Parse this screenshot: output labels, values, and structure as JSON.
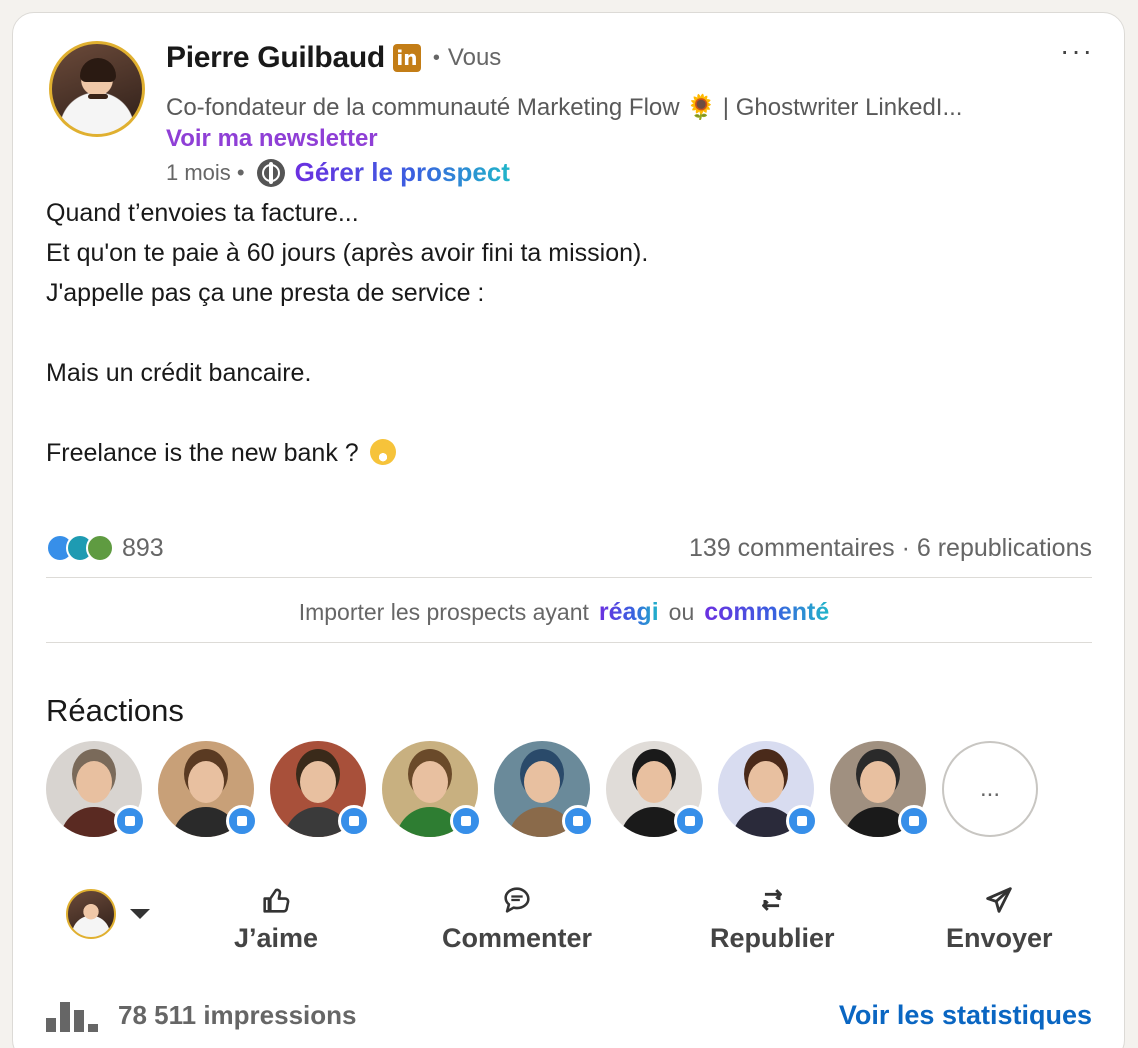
{
  "post": {
    "author": {
      "name": "Pierre Guilbaud",
      "badge": "in",
      "connection_separator": "•",
      "connection": "Vous",
      "headline": "Co-fondateur de la communauté Marketing Flow 🌻 | Ghostwriter LinkedI...",
      "newsletter_link": "Voir ma newsletter"
    },
    "meta": {
      "time": "1 mois •",
      "visibility_icon": "globe-icon",
      "prospect_link": "Gérer le prospect"
    },
    "more_menu": "···",
    "body_lines": [
      "Quand t’envoies ta facture...",
      "Et qu'on te paie à 60 jours (après avoir fini ta mission).",
      "J'appelle pas ça une presta de service :",
      "",
      "Mais un crédit bancaire.",
      "",
      "Freelance is the new bank ?"
    ],
    "body_emoji": "grinning-sweat-emoji"
  },
  "social_counts": {
    "reaction_icons": [
      "like",
      "funny",
      "celebrate"
    ],
    "reactions": "893",
    "comments_reposts": "139 commentaires · 6 republications"
  },
  "import_prospects": {
    "text": "Importer les prospects ayant",
    "reacted_link": "réagi",
    "or": "ou",
    "commented_link": "commenté"
  },
  "reactions_section": {
    "title": "Réactions",
    "more_label": "...",
    "reactors": [
      {
        "bg": "#d8d4d0",
        "body": "#5a2a22",
        "hair": "#7a6a5a"
      },
      {
        "bg": "#c8a078",
        "body": "#2a2a2a",
        "hair": "#5a3a22"
      },
      {
        "bg": "#a8503a",
        "body": "#3a3a3a",
        "hair": "#3a2a1a"
      },
      {
        "bg": "#c8b080",
        "body": "#2e7d32",
        "hair": "#6a4a2a"
      },
      {
        "bg": "#6a8a9a",
        "body": "#8a6a4a",
        "hair": "#2a4a6a"
      },
      {
        "bg": "#e0dcd8",
        "body": "#1a1a1a",
        "hair": "#1a1a1a"
      },
      {
        "bg": "#d8dcf0",
        "body": "#2a2a3a",
        "hair": "#4a2a1a"
      },
      {
        "bg": "#a09080",
        "body": "#1a1a1a",
        "hair": "#2a2a2a"
      }
    ]
  },
  "actions": {
    "like": "J’aime",
    "comment": "Commenter",
    "repost": "Republier",
    "send": "Envoyer"
  },
  "stats": {
    "impressions": "78 511 impressions",
    "view_stats": "Voir les statistiques"
  },
  "colors": {
    "brand_blue": "#0a66c2",
    "newsletter_purple": "#8f3fd6",
    "like_blue": "#378fe9"
  }
}
